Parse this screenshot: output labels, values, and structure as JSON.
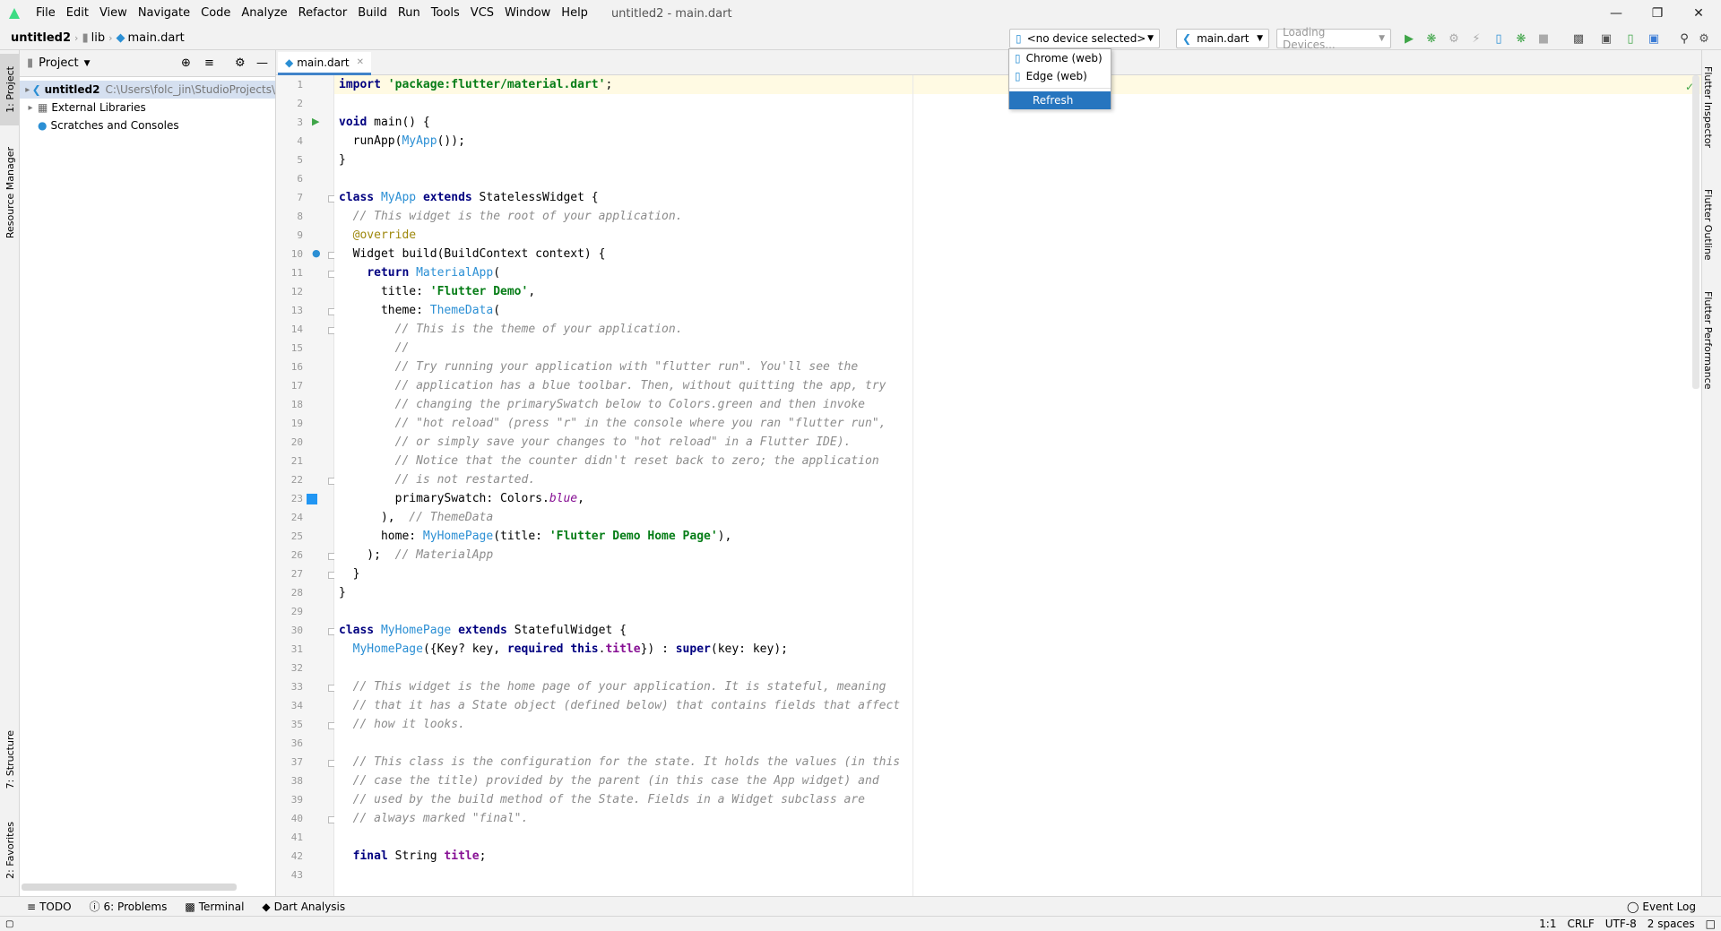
{
  "window": {
    "title": "untitled2 - main.dart",
    "controls": [
      "minimize-icon",
      "maximize-icon",
      "close-icon"
    ]
  },
  "menu": [
    "File",
    "Edit",
    "View",
    "Navigate",
    "Code",
    "Analyze",
    "Refactor",
    "Build",
    "Run",
    "Tools",
    "VCS",
    "Window",
    "Help"
  ],
  "breadcrumb": [
    "untitled2",
    "lib",
    "main.dart"
  ],
  "toolbar": {
    "device_selector": "<no device selected>",
    "run_config": "main.dart",
    "loading_devices": "Loading Devices..."
  },
  "device_popup": {
    "items": [
      "Chrome (web)",
      "Edge (web)",
      "Refresh"
    ],
    "selected": "Refresh"
  },
  "left_tabs": [
    "1: Project",
    "Resource Manager",
    "7: Structure",
    "2: Favorites"
  ],
  "right_tabs": [
    "Flutter Inspector",
    "Flutter Outline",
    "Flutter Performance"
  ],
  "project_panel": {
    "header": "Project",
    "tree": [
      {
        "label": "untitled2",
        "path": "C:\\Users\\folc_jin\\StudioProjects\\",
        "icon": "flutter-icon"
      },
      {
        "label": "External Libraries",
        "icon": "library-icon"
      },
      {
        "label": "Scratches and Consoles",
        "icon": "scratch-icon"
      }
    ]
  },
  "editor": {
    "tab": "main.dart",
    "line_numbers": [
      "1",
      "2",
      "3",
      "4",
      "5",
      "6",
      "7",
      "8",
      "9",
      "10",
      "11",
      "12",
      "13",
      "14",
      "15",
      "16",
      "17",
      "18",
      "19",
      "20",
      "21",
      "22",
      "23",
      "24",
      "25",
      "26",
      "27",
      "28",
      "29",
      "30",
      "31",
      "32",
      "33",
      "34",
      "35",
      "36",
      "37",
      "38",
      "39",
      "40",
      "41",
      "42",
      "43"
    ],
    "lines": [
      "import 'package:flutter/material.dart';",
      "",
      "void main() {",
      "  runApp(MyApp());",
      "}",
      "",
      "class MyApp extends StatelessWidget {",
      "  // This widget is the root of your application.",
      "  @override",
      "  Widget build(BuildContext context) {",
      "    return MaterialApp(",
      "      title: 'Flutter Demo',",
      "      theme: ThemeData(",
      "        // This is the theme of your application.",
      "        //",
      "        // Try running your application with \"flutter run\". You'll see the",
      "        // application has a blue toolbar. Then, without quitting the app, try",
      "        // changing the primarySwatch below to Colors.green and then invoke",
      "        // \"hot reload\" (press \"r\" in the console where you ran \"flutter run\",",
      "        // or simply save your changes to \"hot reload\" in a Flutter IDE).",
      "        // Notice that the counter didn't reset back to zero; the application",
      "        // is not restarted.",
      "        primarySwatch: Colors.blue,",
      "      ),  // ThemeData",
      "      home: MyHomePage(title: 'Flutter Demo Home Page'),",
      "    );  // MaterialApp",
      "  }",
      "}",
      "",
      "class MyHomePage extends StatefulWidget {",
      "  MyHomePage({Key? key, required this.title}) : super(key: key);",
      "",
      "  // This widget is the home page of your application. It is stateful, meaning",
      "  // that it has a State object (defined below) that contains fields that affect",
      "  // how it looks.",
      "",
      "  // This class is the configuration for the state. It holds the values (in this",
      "  // case the title) provided by the parent (in this case the App widget) and",
      "  // used by the build method of the State. Fields in a Widget subclass are",
      "  // always marked \"final\".",
      "",
      "  final String title;",
      ""
    ]
  },
  "bottom_tabs": [
    "TODO",
    "6: Problems",
    "Terminal",
    "Dart Analysis"
  ],
  "event_log": "Event Log",
  "status": {
    "position": "1:1",
    "line_ending": "CRLF",
    "encoding": "UTF-8",
    "indent": "2 spaces"
  },
  "colors": {
    "accent": "#2675bf",
    "keyword": "#000080",
    "string": "#067d17",
    "comment": "#8c8c8c",
    "class": "#2b8fd4"
  }
}
